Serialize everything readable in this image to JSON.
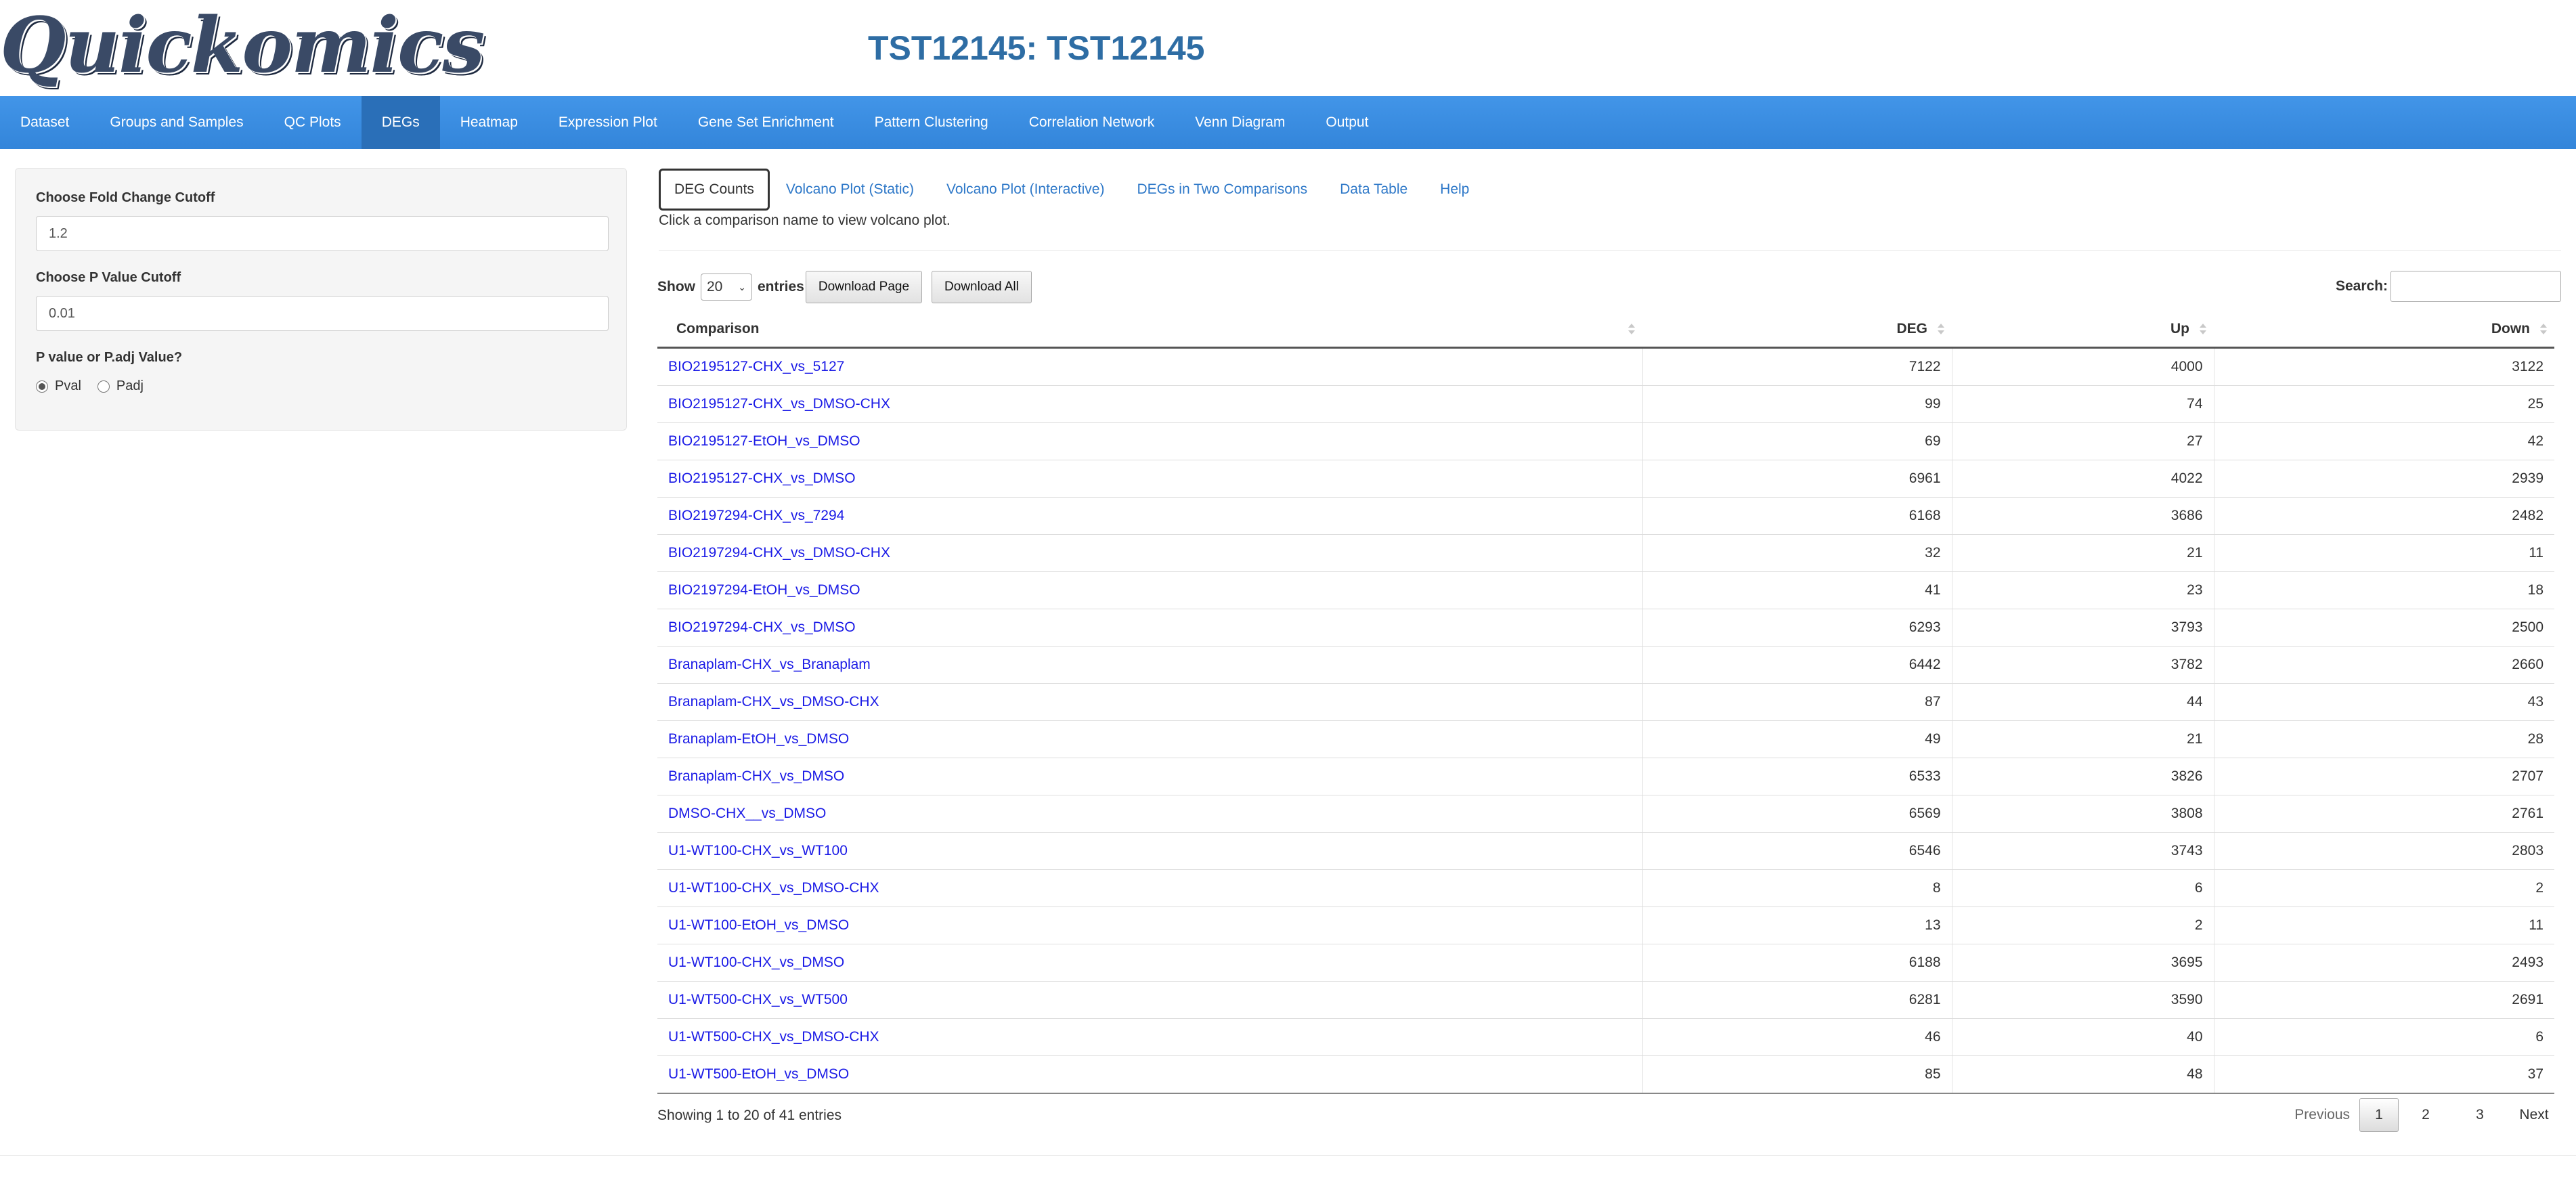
{
  "app": {
    "logo": "Quickomics",
    "title": "TST12145: TST12145"
  },
  "nav": [
    {
      "label": "Dataset",
      "active": false
    },
    {
      "label": "Groups and Samples",
      "active": false
    },
    {
      "label": "QC Plots",
      "active": false
    },
    {
      "label": "DEGs",
      "active": true
    },
    {
      "label": "Heatmap",
      "active": false
    },
    {
      "label": "Expression Plot",
      "active": false
    },
    {
      "label": "Gene Set Enrichment",
      "active": false
    },
    {
      "label": "Pattern Clustering",
      "active": false
    },
    {
      "label": "Correlation Network",
      "active": false
    },
    {
      "label": "Venn Diagram",
      "active": false
    },
    {
      "label": "Output",
      "active": false
    }
  ],
  "sidebar": {
    "fold_label": "Choose Fold Change Cutoff",
    "fold_value": "1.2",
    "pval_label": "Choose P Value Cutoff",
    "pval_value": "0.01",
    "type_label": "P value or P.adj Value?",
    "options": [
      "Pval",
      "Padj"
    ],
    "selected": "Pval"
  },
  "tabs": [
    "DEG Counts",
    "Volcano Plot (Static)",
    "Volcano Plot (Interactive)",
    "DEGs in Two Comparisons",
    "Data Table",
    "Help"
  ],
  "active_tab": "DEG Counts",
  "hint": "Click a comparison name to view volcano plot.",
  "controls": {
    "show": "Show",
    "entries_value": "20",
    "entries": "entries",
    "download_page": "Download Page",
    "download_all": "Download All",
    "search_label": "Search:"
  },
  "table": {
    "headers": [
      "Comparison",
      "DEG",
      "Up",
      "Down"
    ],
    "rows": [
      [
        "BIO2195127-CHX_vs_5127",
        "7122",
        "4000",
        "3122"
      ],
      [
        "BIO2195127-CHX_vs_DMSO-CHX",
        "99",
        "74",
        "25"
      ],
      [
        "BIO2195127-EtOH_vs_DMSO",
        "69",
        "27",
        "42"
      ],
      [
        "BIO2195127-CHX_vs_DMSO",
        "6961",
        "4022",
        "2939"
      ],
      [
        "BIO2197294-CHX_vs_7294",
        "6168",
        "3686",
        "2482"
      ],
      [
        "BIO2197294-CHX_vs_DMSO-CHX",
        "32",
        "21",
        "11"
      ],
      [
        "BIO2197294-EtOH_vs_DMSO",
        "41",
        "23",
        "18"
      ],
      [
        "BIO2197294-CHX_vs_DMSO",
        "6293",
        "3793",
        "2500"
      ],
      [
        "Branaplam-CHX_vs_Branaplam",
        "6442",
        "3782",
        "2660"
      ],
      [
        "Branaplam-CHX_vs_DMSO-CHX",
        "87",
        "44",
        "43"
      ],
      [
        "Branaplam-EtOH_vs_DMSO",
        "49",
        "21",
        "28"
      ],
      [
        "Branaplam-CHX_vs_DMSO",
        "6533",
        "3826",
        "2707"
      ],
      [
        "DMSO-CHX__vs_DMSO",
        "6569",
        "3808",
        "2761"
      ],
      [
        "U1-WT100-CHX_vs_WT100",
        "6546",
        "3743",
        "2803"
      ],
      [
        "U1-WT100-CHX_vs_DMSO-CHX",
        "8",
        "6",
        "2"
      ],
      [
        "U1-WT100-EtOH_vs_DMSO",
        "13",
        "2",
        "11"
      ],
      [
        "U1-WT100-CHX_vs_DMSO",
        "6188",
        "3695",
        "2493"
      ],
      [
        "U1-WT500-CHX_vs_WT500",
        "6281",
        "3590",
        "2691"
      ],
      [
        "U1-WT500-CHX_vs_DMSO-CHX",
        "46",
        "40",
        "6"
      ],
      [
        "U1-WT500-EtOH_vs_DMSO",
        "85",
        "48",
        "37"
      ]
    ]
  },
  "info": "Showing 1 to 20 of 41 entries",
  "pagination": {
    "previous": "Previous",
    "pages": [
      "1",
      "2",
      "3"
    ],
    "current": "1",
    "next": "Next"
  },
  "colors": {
    "navbar": "#3a8de0",
    "nav_active": "#2a6fb8",
    "title": "#2e6da4",
    "link": "#1a1ae6"
  }
}
